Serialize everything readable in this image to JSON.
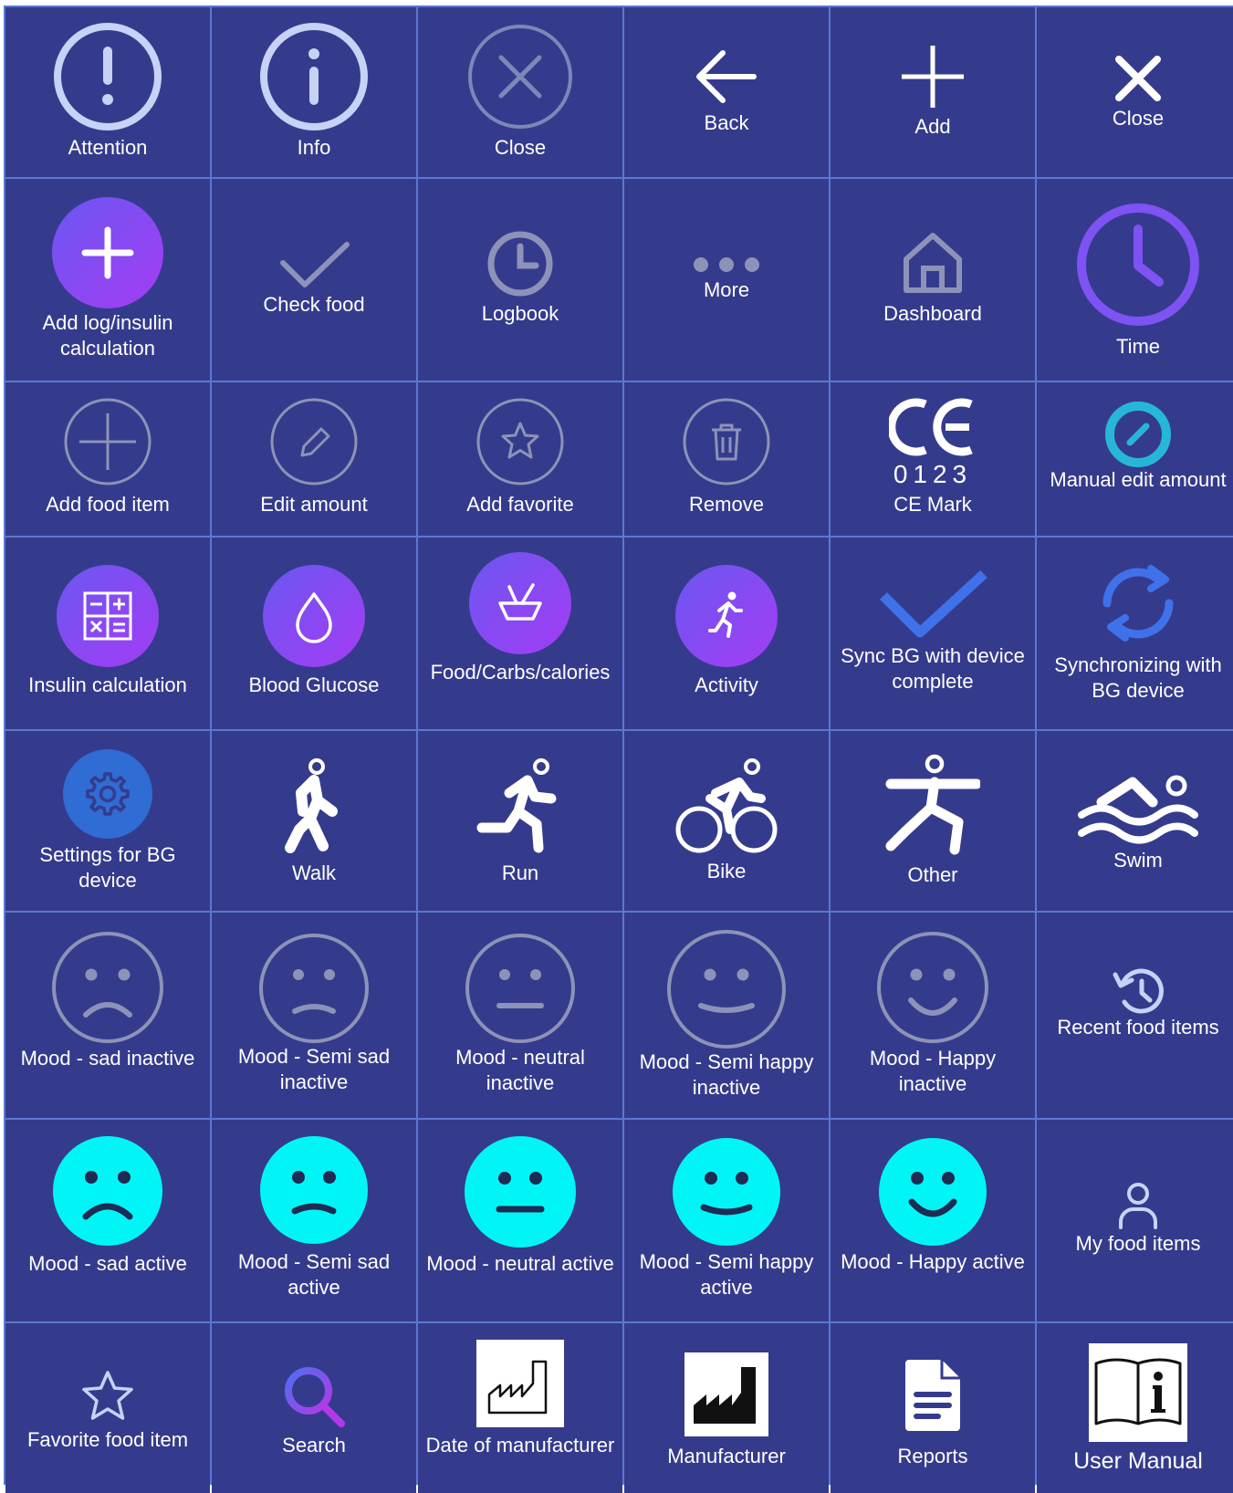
{
  "colors": {
    "background": "#353b8c",
    "grid_line": "#5b78d1",
    "accent_gradient": [
      "#6f53f2",
      "#a13df5"
    ],
    "inactive_gray": "#8d93b8",
    "light_ring": "#c7d2f6",
    "mood_active": "#00f6f6",
    "sync_blue": "#3f72ea",
    "teal": "#27b7d6",
    "time_purple": "#7f52f3",
    "settings_blue": "#2f6cd3"
  },
  "cells": [
    {
      "label": "Attention",
      "icon": "attention-icon"
    },
    {
      "label": "Info",
      "icon": "info-icon"
    },
    {
      "label": "Close",
      "icon": "close-circle-icon"
    },
    {
      "label": "Back",
      "icon": "back-arrow-icon"
    },
    {
      "label": "Add",
      "icon": "plus-icon"
    },
    {
      "label": "Close",
      "icon": "close-x-icon"
    },
    {
      "label": "Add log/insulin calculation",
      "icon": "add-log-icon"
    },
    {
      "label": "Check food",
      "icon": "checkmark-icon"
    },
    {
      "label": "Logbook",
      "icon": "clock-icon"
    },
    {
      "label": "More",
      "icon": "more-dots-icon"
    },
    {
      "label": "Dashboard",
      "icon": "home-icon"
    },
    {
      "label": "Time",
      "icon": "time-clock-icon"
    },
    {
      "label": "Add food item",
      "icon": "add-food-circle-icon"
    },
    {
      "label": "Edit amount",
      "icon": "pencil-circle-icon"
    },
    {
      "label": "Add favorite",
      "icon": "star-circle-icon"
    },
    {
      "label": "Remove",
      "icon": "trash-circle-icon"
    },
    {
      "label": "CE Mark",
      "icon": "ce-mark-icon",
      "code": "0123",
      "mark": "CE"
    },
    {
      "label": "Manual edit amount",
      "icon": "manual-edit-icon"
    },
    {
      "label": "Insulin calculation",
      "icon": "calculator-icon"
    },
    {
      "label": "Blood Glucose",
      "icon": "blood-drop-icon"
    },
    {
      "label": "Food/Carbs/calories",
      "icon": "food-bowl-icon"
    },
    {
      "label": "Activity",
      "icon": "activity-runner-icon"
    },
    {
      "label": "Sync BG with device complete",
      "icon": "sync-complete-check-icon"
    },
    {
      "label": "Synchronizing with BG device",
      "icon": "sync-arrows-icon"
    },
    {
      "label": "Settings for BG device",
      "icon": "gear-icon"
    },
    {
      "label": "Walk",
      "icon": "walk-icon"
    },
    {
      "label": "Run",
      "icon": "run-icon"
    },
    {
      "label": "Bike",
      "icon": "bike-icon"
    },
    {
      "label": "Other",
      "icon": "other-activity-icon"
    },
    {
      "label": "Swim",
      "icon": "swim-icon"
    },
    {
      "label": "Mood - sad inactive",
      "icon": "mood-sad-icon"
    },
    {
      "label": "Mood - Semi sad inactive",
      "icon": "mood-semi-sad-icon"
    },
    {
      "label": "Mood - neutral inactive",
      "icon": "mood-neutral-icon"
    },
    {
      "label": "Mood - Semi happy inactive",
      "icon": "mood-semi-happy-icon"
    },
    {
      "label": "Mood - Happy inactive",
      "icon": "mood-happy-icon"
    },
    {
      "label": "Recent food items",
      "icon": "history-icon"
    },
    {
      "label": "Mood - sad active",
      "icon": "mood-sad-active-icon"
    },
    {
      "label": "Mood - Semi sad active",
      "icon": "mood-semi-sad-active-icon"
    },
    {
      "label": "Mood - neutral active",
      "icon": "mood-neutral-active-icon"
    },
    {
      "label": "Mood - Semi happy active",
      "icon": "mood-semi-happy-active-icon"
    },
    {
      "label": "Mood - Happy active",
      "icon": "mood-happy-active-icon"
    },
    {
      "label": "My food items",
      "icon": "user-icon"
    },
    {
      "label": "Favorite food item",
      "icon": "star-icon"
    },
    {
      "label": "Search",
      "icon": "search-icon"
    },
    {
      "label": "Date of manufacturer",
      "icon": "date-of-manufacture-icon"
    },
    {
      "label": "Manufacturer",
      "icon": "manufacturer-icon"
    },
    {
      "label": "Reports",
      "icon": "report-document-icon"
    },
    {
      "label": "User Manual",
      "icon": "user-manual-icon"
    }
  ]
}
